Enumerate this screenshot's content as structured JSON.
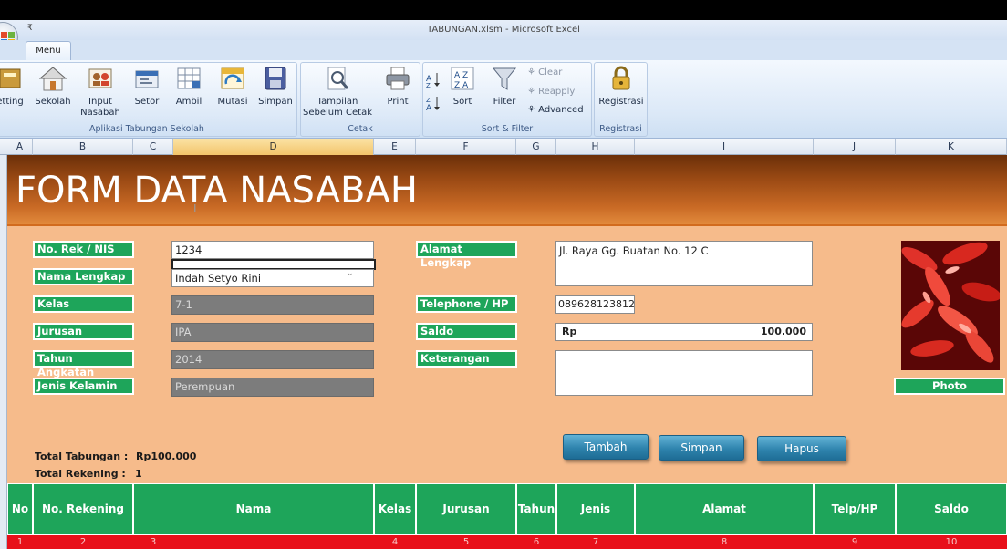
{
  "window": {
    "title": "TABUNGAN.xlsm - Microsoft Excel",
    "qat_symbol": "₹"
  },
  "tabs": [
    {
      "label": "Menu"
    }
  ],
  "ribbon": {
    "groups": [
      {
        "name": "aplikasi",
        "label": "Aplikasi Tabungan Sekolah"
      },
      {
        "name": "cetak",
        "label": "Cetak"
      },
      {
        "name": "sortfilter",
        "label": "Sort & Filter"
      },
      {
        "name": "registrasi",
        "label": "Registrasi"
      }
    ],
    "buttons": {
      "setting": "etting",
      "sekolah": "Sekolah",
      "input_line1": "Input",
      "input_line2": "Nasabah",
      "setor": "Setor",
      "ambil": "Ambil",
      "mutasi": "Mutasi",
      "simpan": "Simpan",
      "tampilan_line1": "Tampilan",
      "tampilan_line2": "Sebelum Cetak",
      "print": "Print",
      "sort": "Sort",
      "filter": "Filter",
      "clear": "Clear",
      "reapply": "Reapply",
      "advanced": "Advanced",
      "registrasi": "Registrasi"
    }
  },
  "columns": [
    "A",
    "B",
    "C",
    "D",
    "E",
    "F",
    "G",
    "H",
    "I",
    "J",
    "K"
  ],
  "form": {
    "title": "FORM DATA NASABAH",
    "labels": {
      "no_rek": "No. Rek / NIS",
      "nama": "Nama Lengkap",
      "kelas": "Kelas",
      "jurusan": "Jurusan",
      "tahun": "Tahun Angkatan",
      "jk": "Jenis Kelamin",
      "alamat": "Alamat Lengkap",
      "telp": "Telephone / HP",
      "saldo": "Saldo",
      "keterangan": "Keterangan",
      "photo": "Photo"
    },
    "values": {
      "no_rek": "1234",
      "nama": "Indah Setyo Rini",
      "kelas": "7-1",
      "jurusan": "IPA",
      "tahun": "2014",
      "jk": "Perempuan",
      "alamat": "Jl. Raya Gg. Buatan No. 12 C",
      "telp": "089628123812",
      "saldo_currency": "Rp",
      "saldo_amount": "100.000",
      "keterangan": ""
    },
    "buttons": {
      "tambah": "Tambah",
      "simpan": "Simpan",
      "hapus": "Hapus"
    },
    "totals": {
      "tabungan_label": "Total Tabungan :",
      "tabungan_value": "Rp100.000",
      "rekening_label": "Total Rekening :",
      "rekening_value": "1"
    }
  },
  "table": {
    "headers": [
      "No",
      "No. Rekening",
      "Nama",
      "Kelas",
      "Jurusan",
      "Tahun",
      "Jenis Kelamin",
      "Alamat",
      "Telp/HP",
      "Saldo"
    ],
    "numbers": [
      "1",
      "2",
      "3",
      "4",
      "5",
      "6",
      "7",
      "8",
      "9",
      "10"
    ]
  },
  "colors": {
    "green": "#1ea55a",
    "orange_bg": "#f6bb8b",
    "button_blue": "#2e83ad",
    "red_row": "#e8101a"
  }
}
